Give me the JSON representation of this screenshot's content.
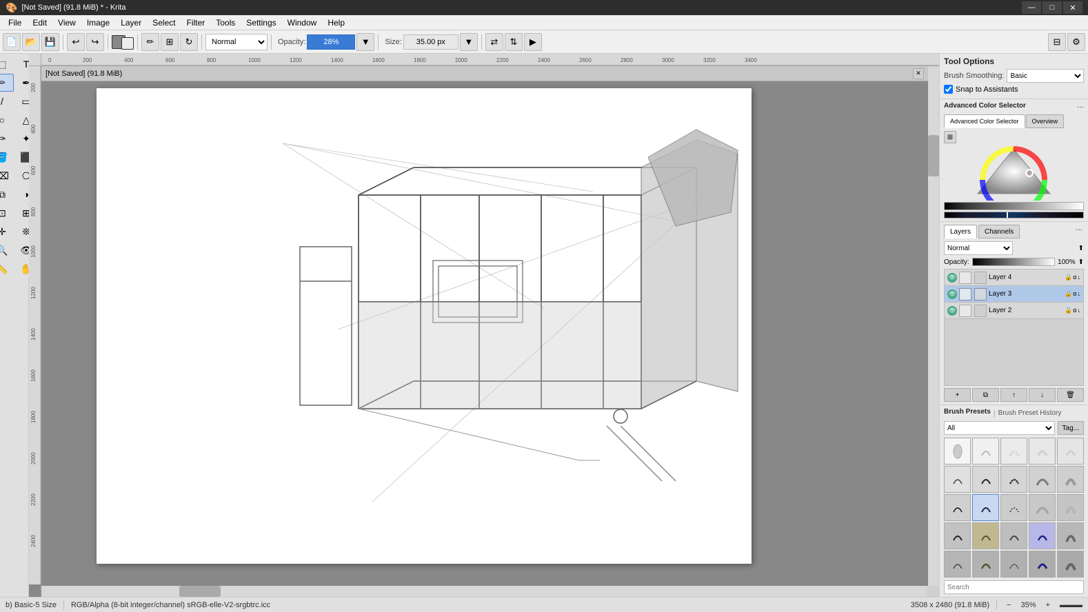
{
  "titlebar": {
    "title": "[Not Saved] (91.8 MiB) * - Krita",
    "min_btn": "—",
    "max_btn": "□",
    "close_btn": "✕"
  },
  "menubar": {
    "items": [
      "File",
      "Edit",
      "View",
      "Image",
      "Layer",
      "Select",
      "Filter",
      "Tools",
      "Settings",
      "Window",
      "Help"
    ]
  },
  "toolbar": {
    "blend_mode": "Normal",
    "opacity_label": "Opacity:",
    "opacity_value": "28%",
    "size_label": "Size:",
    "size_value": "35.00 px"
  },
  "canvas": {
    "title": "[Not Saved] (91.8 MiB)",
    "zoom": "35%"
  },
  "tool_options": {
    "title": "Tool Options",
    "brush_smoothing_label": "Brush Smoothing:",
    "brush_smoothing_value": "Basic",
    "snap_label": "Snap to Assistants"
  },
  "color_selector": {
    "title": "Advanced Color Selector",
    "tab_advanced": "Advanced Color Selector",
    "tab_overview": "Overview"
  },
  "layers": {
    "title": "Layers",
    "tabs": [
      "Layers",
      "Channels"
    ],
    "blend_mode": "Normal",
    "opacity_label": "Opacity:",
    "opacity_value": "100%",
    "items": [
      {
        "name": "Layer 4",
        "visible": true,
        "selected": false
      },
      {
        "name": "Layer 3",
        "visible": true,
        "selected": true
      },
      {
        "name": "Layer 2",
        "visible": true,
        "selected": false
      }
    ]
  },
  "brush_presets": {
    "title": "Brush Presets",
    "subtitle": "Brush Preset History",
    "tag_btn": "Tag...",
    "all_label": "All",
    "search_placeholder": "Search"
  },
  "statusbar": {
    "tool_info": "b) Basic-5 Size",
    "color_info": "RGB/Alpha (8-bit integer/channel)  sRGB-elle-V2-srgbtrc.icc",
    "dimensions": "3508 x 2480 (91.8 MiB)",
    "zoom": "35%"
  }
}
